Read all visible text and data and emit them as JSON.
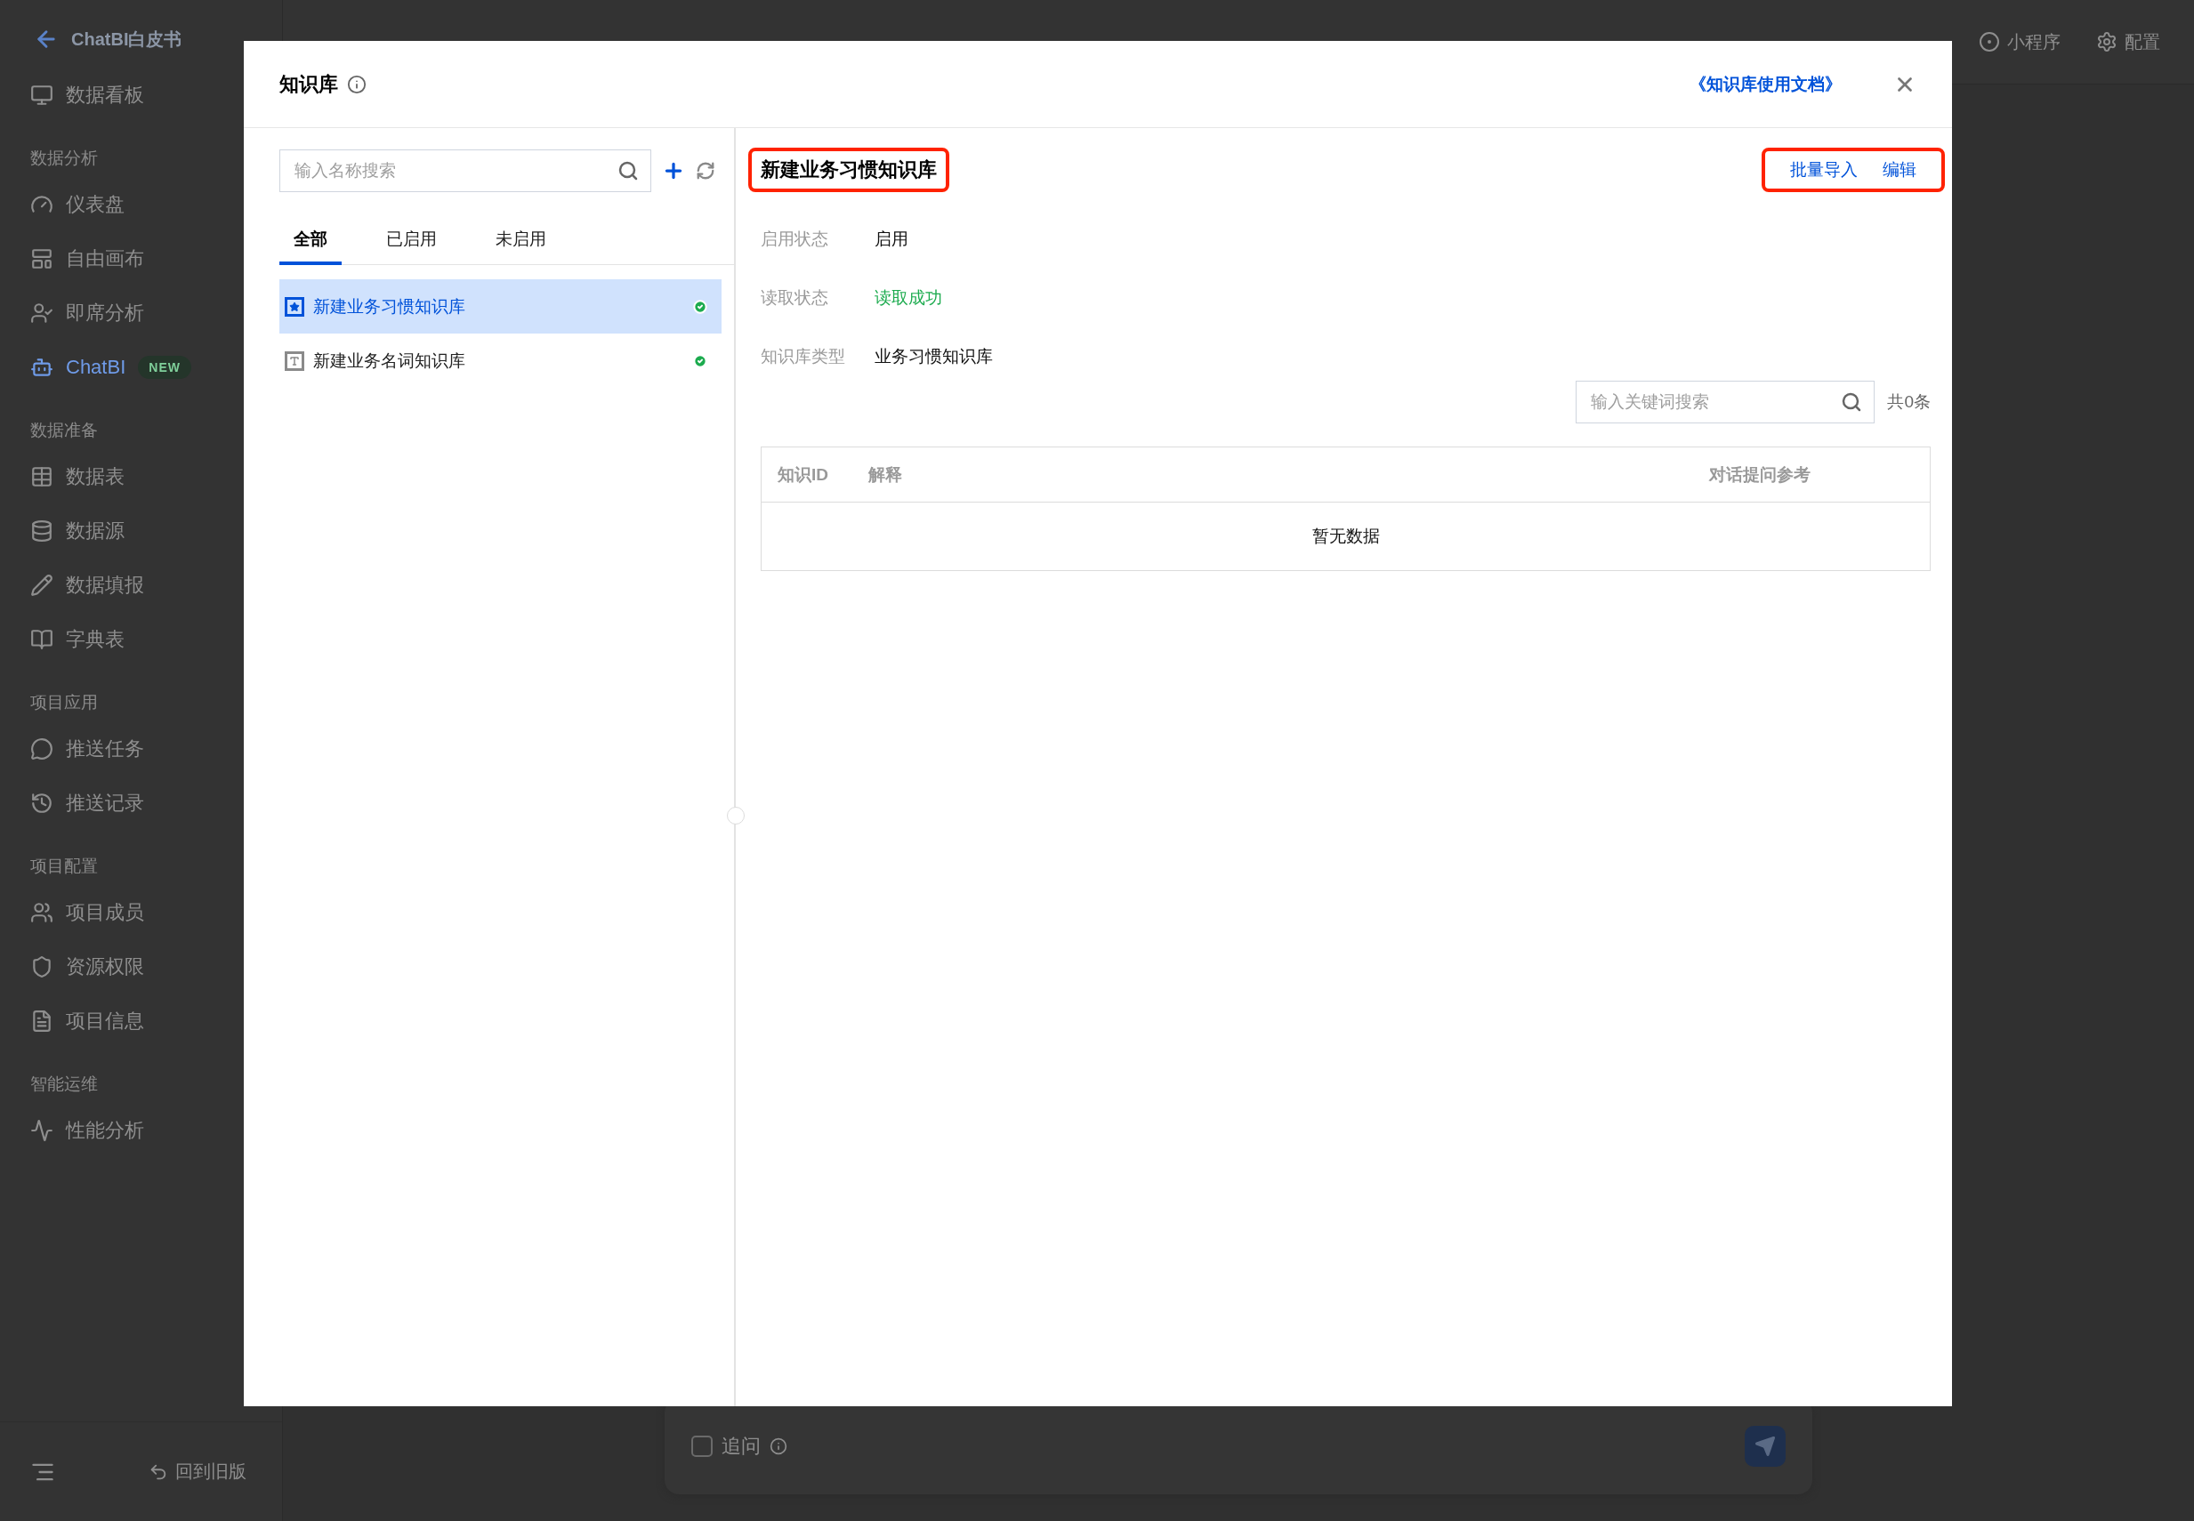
{
  "sidebar": {
    "back_title": "ChatBI白皮书",
    "sections": [
      {
        "items": [
          {
            "label": "数据看板",
            "selected": false
          }
        ]
      },
      {
        "title": "数据分析",
        "items": [
          {
            "label": "仪表盘",
            "selected": false
          },
          {
            "label": "自由画布",
            "selected": false
          },
          {
            "label": "即席分析",
            "selected": false
          },
          {
            "label": "ChatBI",
            "selected": true,
            "badge": "NEW"
          }
        ]
      },
      {
        "title": "数据准备",
        "items": [
          {
            "label": "数据表",
            "selected": false
          },
          {
            "label": "数据源",
            "selected": false
          },
          {
            "label": "数据填报",
            "selected": false
          },
          {
            "label": "字典表",
            "selected": false
          }
        ]
      },
      {
        "title": "项目应用",
        "items": [
          {
            "label": "推送任务",
            "selected": false
          },
          {
            "label": "推送记录",
            "selected": false
          }
        ]
      },
      {
        "title": "项目配置",
        "items": [
          {
            "label": "项目成员",
            "selected": false
          },
          {
            "label": "资源权限",
            "selected": false
          },
          {
            "label": "项目信息",
            "selected": false
          }
        ]
      },
      {
        "title": "智能运维",
        "items": [
          {
            "label": "性能分析",
            "selected": false
          }
        ]
      }
    ],
    "footer": {
      "old_version": "回到旧版"
    }
  },
  "top_bar": {
    "actions": [
      "小程序",
      "配置"
    ]
  },
  "chat_input": {
    "follow_up": {
      "label": "追问",
      "checked": false
    }
  },
  "modal": {
    "title": "知识库",
    "doc_link": "《知识库使用文档》",
    "left": {
      "search": {
        "placeholder": "输入名称搜索"
      },
      "tabs": [
        {
          "label": "全部",
          "selected": true
        },
        {
          "label": "已启用",
          "selected": false
        },
        {
          "label": "未启用",
          "selected": false
        }
      ],
      "items": [
        {
          "kind": "habit",
          "label": "新建业务习惯知识库",
          "selected": true,
          "enabled": true
        },
        {
          "kind": "term",
          "label": "新建业务名词知识库",
          "selected": false,
          "enabled": true
        }
      ]
    },
    "right": {
      "title": "新建业务习惯知识库",
      "title_highlighted": true,
      "actions": [
        "批量导入",
        "编辑"
      ],
      "actions_highlighted": true,
      "fields": [
        {
          "label": "启用状态",
          "value": "启用",
          "kind": "plain"
        },
        {
          "label": "读取状态",
          "value": "读取成功",
          "kind": "success"
        },
        {
          "label": "知识库类型",
          "value": "业务习惯知识库",
          "kind": "plain"
        }
      ],
      "search": {
        "placeholder": "输入关键词搜索"
      },
      "count": "共0条",
      "table": {
        "columns": [
          "知识ID",
          "解释",
          "对话提问参考"
        ],
        "empty": "暂无数据"
      }
    }
  }
}
